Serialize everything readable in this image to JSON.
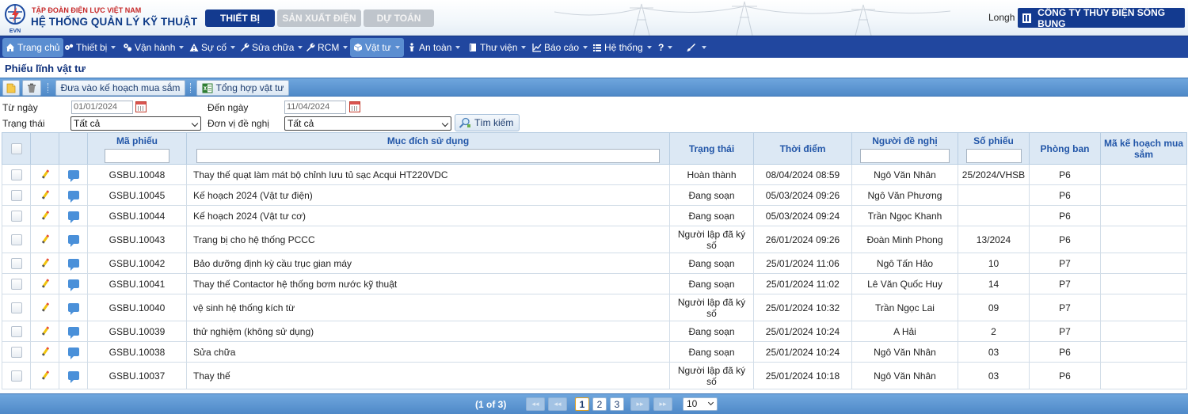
{
  "header": {
    "org_sub": "TẬP ĐOÀN ĐIỆN LỰC VIỆT NAM",
    "org_main": "HỆ THỐNG QUẢN LÝ KỸ THUẬT",
    "logo_text": "EVN",
    "tabs": [
      {
        "label": "THIẾT BỊ",
        "active": true
      },
      {
        "label": "SẢN XUẤT ĐIỆN",
        "active": false
      },
      {
        "label": "DỰ TOÁN",
        "active": false
      }
    ],
    "user": "Longh",
    "company": "CÔNG TY THỦY ĐIỆN SÔNG BUNG"
  },
  "menu": {
    "items": [
      {
        "label": "Trang chủ",
        "icon": "home-icon"
      },
      {
        "label": "Thiết bị",
        "icon": "gears-icon"
      },
      {
        "label": "Vận hành",
        "icon": "cogs-icon"
      },
      {
        "label": "Sự cố",
        "icon": "warning-icon"
      },
      {
        "label": "Sửa chữa",
        "icon": "wrench-icon"
      },
      {
        "label": "RCM",
        "icon": "wrench-icon"
      },
      {
        "label": "Vật tư",
        "icon": "cube-icon"
      },
      {
        "label": "An toàn",
        "icon": "person-icon"
      },
      {
        "label": "Thư viện",
        "icon": "book-icon"
      },
      {
        "label": "Báo cáo",
        "icon": "chart-icon"
      },
      {
        "label": "Hệ thống",
        "icon": "list-icon"
      },
      {
        "label": "?",
        "icon": "help-icon"
      },
      {
        "label": "",
        "icon": "brush-icon"
      }
    ]
  },
  "page": {
    "title": "Phiếu lĩnh vật tư"
  },
  "toolbar": {
    "purchase_plan_label": "Đưa vào kế hoạch mua sắm",
    "summary_label": "Tổng hợp vật tư"
  },
  "filters": {
    "from_label": "Từ ngày",
    "from_value": "01/01/2024",
    "to_label": "Đến ngày",
    "to_value": "11/04/2024",
    "status_label": "Trạng thái",
    "status_value": "Tất cả",
    "unit_label": "Đơn vị đề nghị",
    "unit_value": "Tất cả",
    "search_label": "Tìm kiếm"
  },
  "table": {
    "columns": [
      "Mã phiếu",
      "Mục đích sử dụng",
      "Trạng thái",
      "Thời điểm",
      "Người đề nghị",
      "Số phiếu",
      "Phòng ban",
      "Mã kế hoạch mua sắm"
    ],
    "rows": [
      {
        "code": "GSBU.10048",
        "purpose": "Thay thế quạt làm mát bộ chỉnh lưu tủ sạc Acqui HT220VDC",
        "status": "Hoàn thành",
        "time": "08/04/2024 08:59",
        "requester": "Ngô Văn Nhân",
        "number": "25/2024/VHSB",
        "dept": "P6",
        "plan": ""
      },
      {
        "code": "GSBU.10045",
        "purpose": "Kế hoạch 2024 (Vật tư điện)",
        "status": "Đang soạn",
        "time": "05/03/2024 09:26",
        "requester": "Ngô Văn Phương",
        "number": "",
        "dept": "P6",
        "plan": ""
      },
      {
        "code": "GSBU.10044",
        "purpose": "Kế hoạch 2024 (Vật tư cơ)",
        "status": "Đang soạn",
        "time": "05/03/2024 09:24",
        "requester": "Trần Ngọc Khanh",
        "number": "",
        "dept": "P6",
        "plan": ""
      },
      {
        "code": "GSBU.10043",
        "purpose": "Trang bị cho hệ thống PCCC",
        "status": "Người lập đã ký số",
        "time": "26/01/2024 09:26",
        "requester": "Đoàn Minh Phong",
        "number": "13/2024",
        "dept": "P6",
        "plan": ""
      },
      {
        "code": "GSBU.10042",
        "purpose": "Bảo dưỡng định kỳ cầu trục gian máy",
        "status": "Đang soạn",
        "time": "25/01/2024 11:06",
        "requester": "Ngô Tấn Hảo",
        "number": "10",
        "dept": "P7",
        "plan": ""
      },
      {
        "code": "GSBU.10041",
        "purpose": "Thay thế Contactor hệ thống bơm nước kỹ thuật",
        "status": "Đang soạn",
        "time": "25/01/2024 11:02",
        "requester": "Lê Văn Quốc Huy",
        "number": "14",
        "dept": "P7",
        "plan": ""
      },
      {
        "code": "GSBU.10040",
        "purpose": "vệ sinh hệ thống kích từ",
        "status": "Người lập đã ký số",
        "time": "25/01/2024 10:32",
        "requester": "Trần Ngọc Lai",
        "number": "09",
        "dept": "P7",
        "plan": ""
      },
      {
        "code": "GSBU.10039",
        "purpose": "thử nghiệm (không sử dụng)",
        "status": "Đang soạn",
        "time": "25/01/2024 10:24",
        "requester": "A Hải",
        "number": "2",
        "dept": "P7",
        "plan": ""
      },
      {
        "code": "GSBU.10038",
        "purpose": "Sửa chữa",
        "status": "Đang soạn",
        "time": "25/01/2024 10:24",
        "requester": "Ngô Văn Nhân",
        "number": "03",
        "dept": "P6",
        "plan": ""
      },
      {
        "code": "GSBU.10037",
        "purpose": "Thay thế",
        "status": "Người lập đã ký số",
        "time": "25/01/2024 10:18",
        "requester": "Ngô Văn Nhân",
        "number": "03",
        "dept": "P6",
        "plan": ""
      }
    ]
  },
  "pager": {
    "info": "(1 of 3)",
    "first": "◂◂",
    "prev": "◂◂",
    "next": "▸▸",
    "last": "▸▸",
    "pages": [
      "1",
      "2",
      "3"
    ],
    "page_size": "10"
  },
  "colors": {
    "brand": "#133a8f",
    "menu": "#21479f",
    "accent": "#4f89c8"
  }
}
